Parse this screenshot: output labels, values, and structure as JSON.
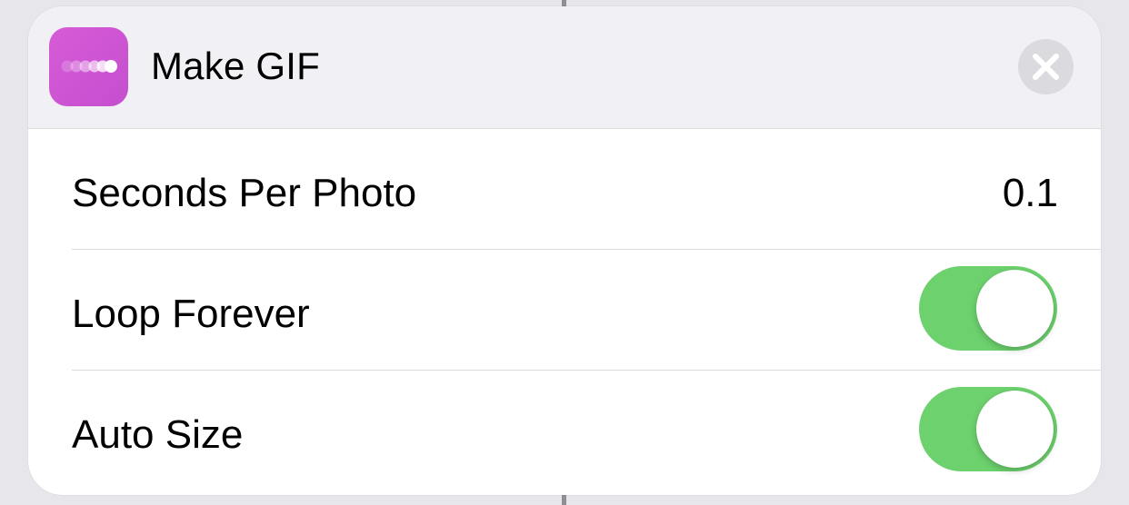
{
  "action": {
    "title": "Make GIF",
    "icon": "gif-dots-icon",
    "icon_color": "#cd55d3"
  },
  "close": {
    "icon": "close-icon"
  },
  "parameters": [
    {
      "label": "Seconds Per Photo",
      "value": "0.1"
    },
    {
      "label": "Loop Forever",
      "toggle_on": true
    },
    {
      "label": "Auto Size",
      "toggle_on": true
    }
  ],
  "colors": {
    "toggle_on": "#6dd26e",
    "card_header": "#f1f1f5",
    "background": "#e6e6eb"
  }
}
